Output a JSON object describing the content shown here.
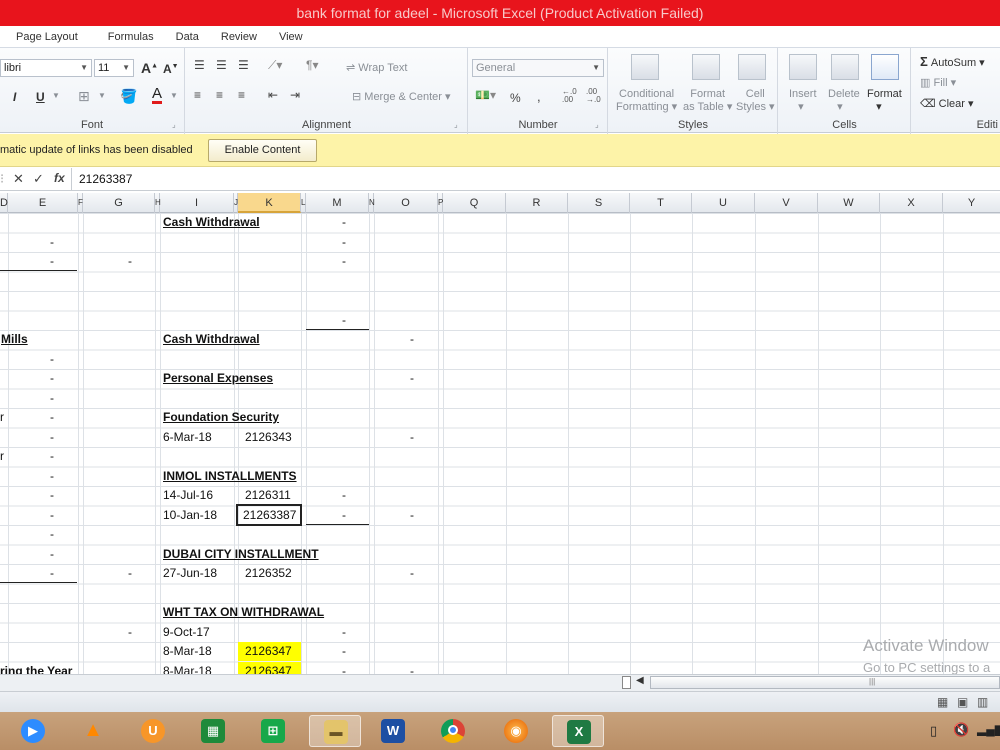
{
  "window": {
    "title": "bank format for adeel  -  Microsoft Excel (Product Activation Failed)"
  },
  "ribbon_tabs": [
    "Page Layout",
    "Formulas",
    "Data",
    "Review",
    "View"
  ],
  "ribbon": {
    "font": {
      "name": "libri",
      "size": "11",
      "label": "Font",
      "bold": "I",
      "underline": "U"
    },
    "alignment": {
      "wrap_text": "Wrap Text",
      "merge_center": "Merge & Center",
      "label": "Alignment"
    },
    "number": {
      "format": "General",
      "percent": "%",
      "comma": ",",
      "label": "Number",
      "inc_decimal": "+.0\n.00",
      "dec_decimal": ".00\n→.0"
    },
    "styles": {
      "conditional": "Conditional",
      "formatting": "Formatting",
      "format": "Format",
      "as_table": "as Table",
      "cell": "Cell",
      "cell_styles": "Styles",
      "label": "Styles"
    },
    "cells": {
      "insert": "Insert",
      "delete": "Delete",
      "format": "Format",
      "label": "Cells"
    },
    "editing": {
      "autosum": "AutoSum",
      "fill": "Fill",
      "clear": "Clear",
      "label": "Editi"
    }
  },
  "security_bar": {
    "message": "matic update of links has been disabled",
    "button": "Enable Content"
  },
  "formula_bar": {
    "cancel": "✕",
    "enter": "✓",
    "fx": "fx",
    "content": "21263387"
  },
  "columns": [
    "D",
    "E",
    "F",
    "G",
    "H",
    "I",
    "J",
    "K",
    "L",
    "M",
    "N",
    "O",
    "P",
    "Q",
    "R",
    "S",
    "T",
    "U",
    "V",
    "W",
    "X",
    "Y"
  ],
  "cells": {
    "cash_withdrawal_1": "Cash Withdrawal",
    "mills": "Mills",
    "cash_withdrawal_2": "Cash Withdrawal",
    "personal_expenses": "Personal Expenses",
    "foundation_security": "Foundation Security",
    "fs_date": "6-Mar-18",
    "fs_value": "2126343",
    "inmol": "INMOL INSTALLMENTS",
    "inmol_date1": "14-Jul-16",
    "inmol_val1": "2126311",
    "inmol_date2": "10-Jan-18",
    "inmol_val2": "21263387",
    "dubai": "DUBAI CITY INSTALLMENT",
    "dubai_date": "27-Jun-18",
    "dubai_val": "2126352",
    "wht": "WHT TAX ON WITHDRAWAL",
    "wht_date1": "9-Oct-17",
    "wht_date2": "8-Mar-18",
    "wht_val2": "2126347",
    "wht_date3": "8-Mar-18",
    "wht_val3": "2126347",
    "ring_year": "ring the Year",
    "dash": "-",
    "r_label": "r"
  },
  "watermark": {
    "line1": "Activate Window",
    "line2": "Go to PC settings to a"
  },
  "taskbar": {
    "icons": [
      "zoom-icon",
      "vlc-icon",
      "uc-browser-icon",
      "calculator-icon",
      "store-icon",
      "file-explorer-icon",
      "word-icon",
      "chrome-icon",
      "firefox-icon",
      "excel-icon"
    ]
  },
  "colors": {
    "titlebar": "#e8141c",
    "security_bar": "#fdf3a8",
    "highlight": "#ffff00"
  }
}
